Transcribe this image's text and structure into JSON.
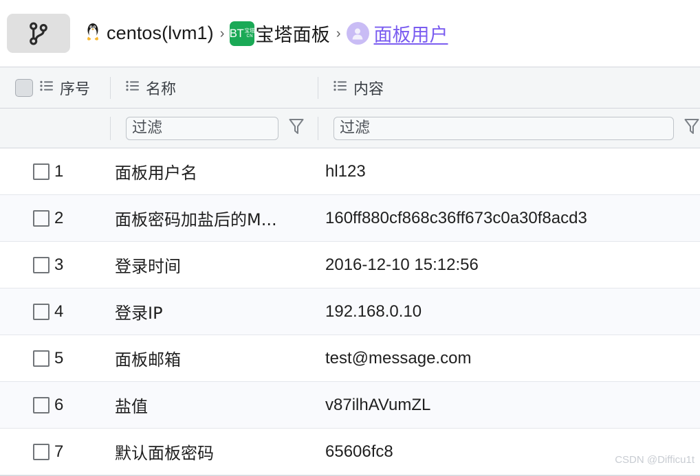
{
  "toolbar": {
    "branch_button": {
      "icon": "git-branch-icon",
      "label": ""
    }
  },
  "breadcrumb": {
    "separator": "›",
    "items": [
      {
        "icon": "linux-tux-icon",
        "label": "centos(lvm1)",
        "is_link": false
      },
      {
        "icon": "bt-panel-logo-icon",
        "label": "宝塔面板",
        "is_link": false
      },
      {
        "icon": "user-avatar-icon",
        "label": "面板用户",
        "is_link": true
      }
    ],
    "link_color": "#7a5cf0",
    "bt_logo": {
      "main": "BT",
      "sub_top": "宝塔",
      "sub_bottom": "CN",
      "color": "#1aa956"
    }
  },
  "table": {
    "columns": [
      {
        "key": "index",
        "label": "序号",
        "icon": "list-columns-icon"
      },
      {
        "key": "name",
        "label": "名称",
        "icon": "list-columns-icon"
      },
      {
        "key": "value",
        "label": "内容",
        "icon": "list-columns-icon"
      }
    ],
    "select_all_checkbox": {
      "checked": false,
      "state": "disabled"
    },
    "filters": {
      "name_placeholder": "过滤",
      "name_value": "",
      "value_placeholder": "过滤",
      "value_value": "",
      "funnel_icon": "funnel-filter-icon"
    },
    "rows": [
      {
        "index": "1",
        "name": "面板用户名",
        "value": "hl123",
        "checked": false
      },
      {
        "index": "2",
        "name": "面板密码加盐后的M...",
        "value": "160ff880cf868c36ff673c0a30f8acd3",
        "checked": false
      },
      {
        "index": "3",
        "name": "登录时间",
        "value": "2016-12-10 15:12:56",
        "checked": false
      },
      {
        "index": "4",
        "name": "登录IP",
        "value": "192.168.0.10",
        "checked": false
      },
      {
        "index": "5",
        "name": "面板邮箱",
        "value": "test@message.com",
        "checked": false
      },
      {
        "index": "6",
        "name": "盐值",
        "value": "v87ilhAVumZL",
        "checked": false
      },
      {
        "index": "7",
        "name": "默认面板密码",
        "value": "65606fc8",
        "checked": false
      }
    ]
  },
  "watermark": {
    "text": "CSDN @Difficu1t"
  }
}
